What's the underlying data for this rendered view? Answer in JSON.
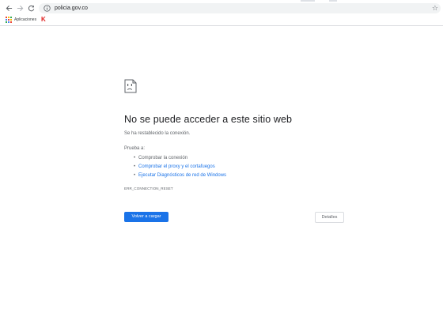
{
  "browser": {
    "url": "policia.gov.co",
    "bookmarks": {
      "apps_label": "Aplicaciones",
      "k_logo": "K"
    }
  },
  "error_page": {
    "title": "No se puede acceder a este sitio web",
    "subtitle": "Se ha restablecido la conexión.",
    "try_label": "Prueba a:",
    "suggestions": [
      {
        "text": "Comprobar la conexión",
        "link": false
      },
      {
        "text": "Comprobar el proxy y el cortafuegos",
        "link": true
      },
      {
        "text": "Ejecutar Diagnósticos de red de Windows",
        "link": true
      }
    ],
    "error_code": "ERR_CONNECTION_RESET",
    "reload_label": "Volver a cargar",
    "details_label": "Detalles"
  },
  "colors": {
    "accent": "#1a73e8",
    "text": "#202124",
    "secondary_text": "#5f6368"
  },
  "icons": [
    "back-arrow-icon",
    "forward-arrow-icon",
    "reload-icon",
    "info-icon",
    "star-icon",
    "apps-grid-icon",
    "sad-page-icon"
  ]
}
